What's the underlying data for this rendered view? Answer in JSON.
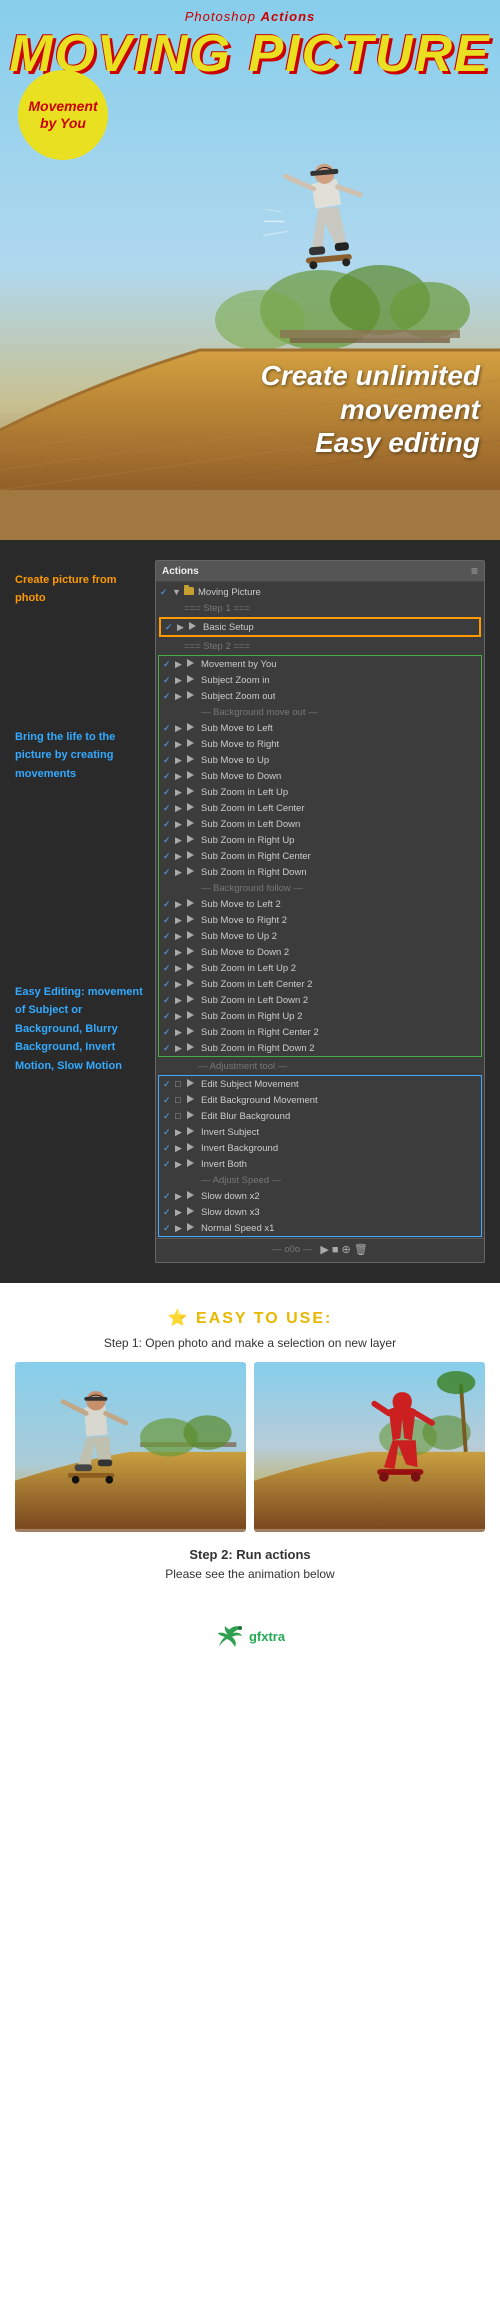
{
  "header": {
    "photoshop_label": "Photoshop",
    "actions_label": "Actions",
    "main_title": "MOVING PICTURE"
  },
  "badge": {
    "line1": "Movement",
    "line2": "by You"
  },
  "hero": {
    "create_line1": "Create unlimited",
    "create_line2": "movement",
    "create_line3": "Easy editing"
  },
  "left_labels": [
    {
      "id": "label1",
      "text": "Create picture from photo",
      "color": "orange"
    },
    {
      "id": "label2",
      "text": "Bring the life to the picture by creating movements",
      "color": "blue"
    },
    {
      "id": "label3",
      "text": "Easy Editing: movement of Subject or Background, Blurry Background, Invert Motion, Slow Motion",
      "color": "blue"
    }
  ],
  "actions_panel": {
    "title": "Actions",
    "menu_icon": "≡",
    "moving_picture_folder": "Moving Picture",
    "step1_separator": "=== Step 1 ===",
    "basic_setup": "Basic Setup",
    "step2_separator": "=== Step 2 ===",
    "actions": [
      "Movement by You",
      "Subject Zoom in",
      "Subject Zoom out",
      "— Background move out —",
      "Sub Move to Left",
      "Sub Move to Right",
      "Sub Move to Up",
      "Sub Move to Down",
      "Sub Zoom in Left Up",
      "Sub Zoom in Left Center",
      "Sub Zoom in Left Down",
      "Sub Zoom in Right Up",
      "Sub Zoom in Right Center",
      "Sub Zoom in Right Down",
      "— Background follow —",
      "Sub Move to Left 2",
      "Sub Move to Right 2",
      "Sub Move to Up 2",
      "Sub Move to Down 2",
      "Sub Zoom in Left Up 2",
      "Sub Zoom in Left Center 2",
      "Sub Zoom in Left Down 2",
      "Sub Zoom in Right Up 2",
      "Sub Zoom in Right Center 2",
      "Sub Zoom in Right Down 2",
      "— Adjustment tool —",
      "Edit Subject Movement",
      "Edit Background Movement",
      "Edit Blur Background",
      "Invert Subject",
      "Invert Background",
      "Invert Both",
      "— Adjust Speed —",
      "Slow down x2",
      "Slow down x3",
      "Normal Speed x1"
    ],
    "bottom_bar": "— o0o —"
  },
  "easy_section": {
    "title": "EASY TO USE:",
    "step1": "Step 1: Open photo and make a selection on new layer",
    "step2": "Step 2: Run actions",
    "step3": "Please see the animation below"
  },
  "footer": {
    "site": "gfxtra"
  }
}
